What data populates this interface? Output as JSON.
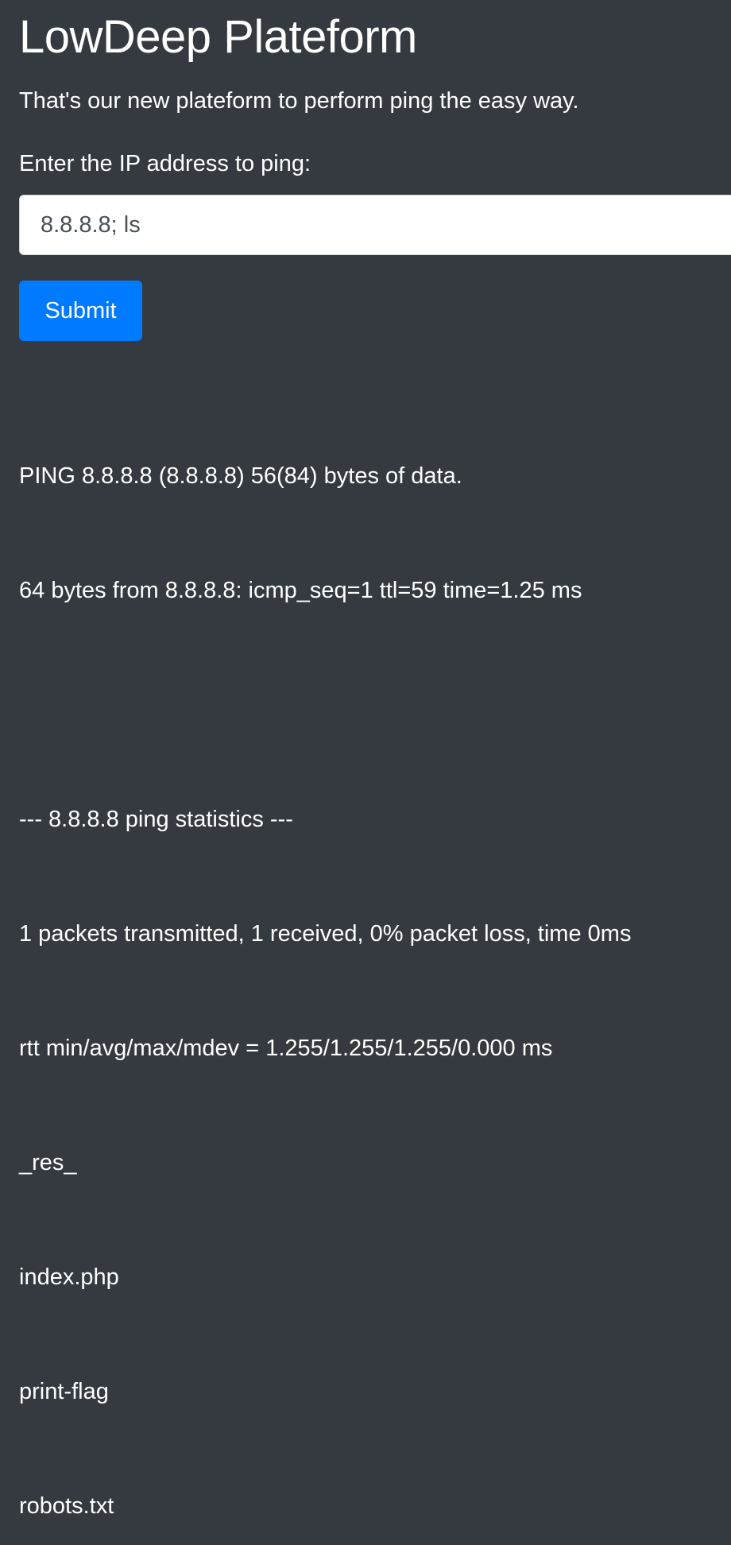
{
  "page": {
    "title": "LowDeep Plateform",
    "lead": "That's our new plateform to perform ping the easy way."
  },
  "form": {
    "label": "Enter the IP address to ping:",
    "ip_value": "8.8.8.8; ls",
    "submit_label": "Submit"
  },
  "output": {
    "lines": [
      "PING 8.8.8.8 (8.8.8.8) 56(84) bytes of data.",
      "64 bytes from 8.8.8.8: icmp_seq=1 ttl=59 time=1.25 ms",
      "",
      "--- 8.8.8.8 ping statistics ---",
      "1 packets transmitted, 1 received, 0% packet loss, time 0ms",
      "rtt min/avg/max/mdev = 1.255/1.255/1.255/0.000 ms",
      "_res_",
      "index.php",
      "print-flag",
      "robots.txt"
    ]
  },
  "colors": {
    "background": "#343a40",
    "primary": "#007bff",
    "text": "#ffffff"
  }
}
